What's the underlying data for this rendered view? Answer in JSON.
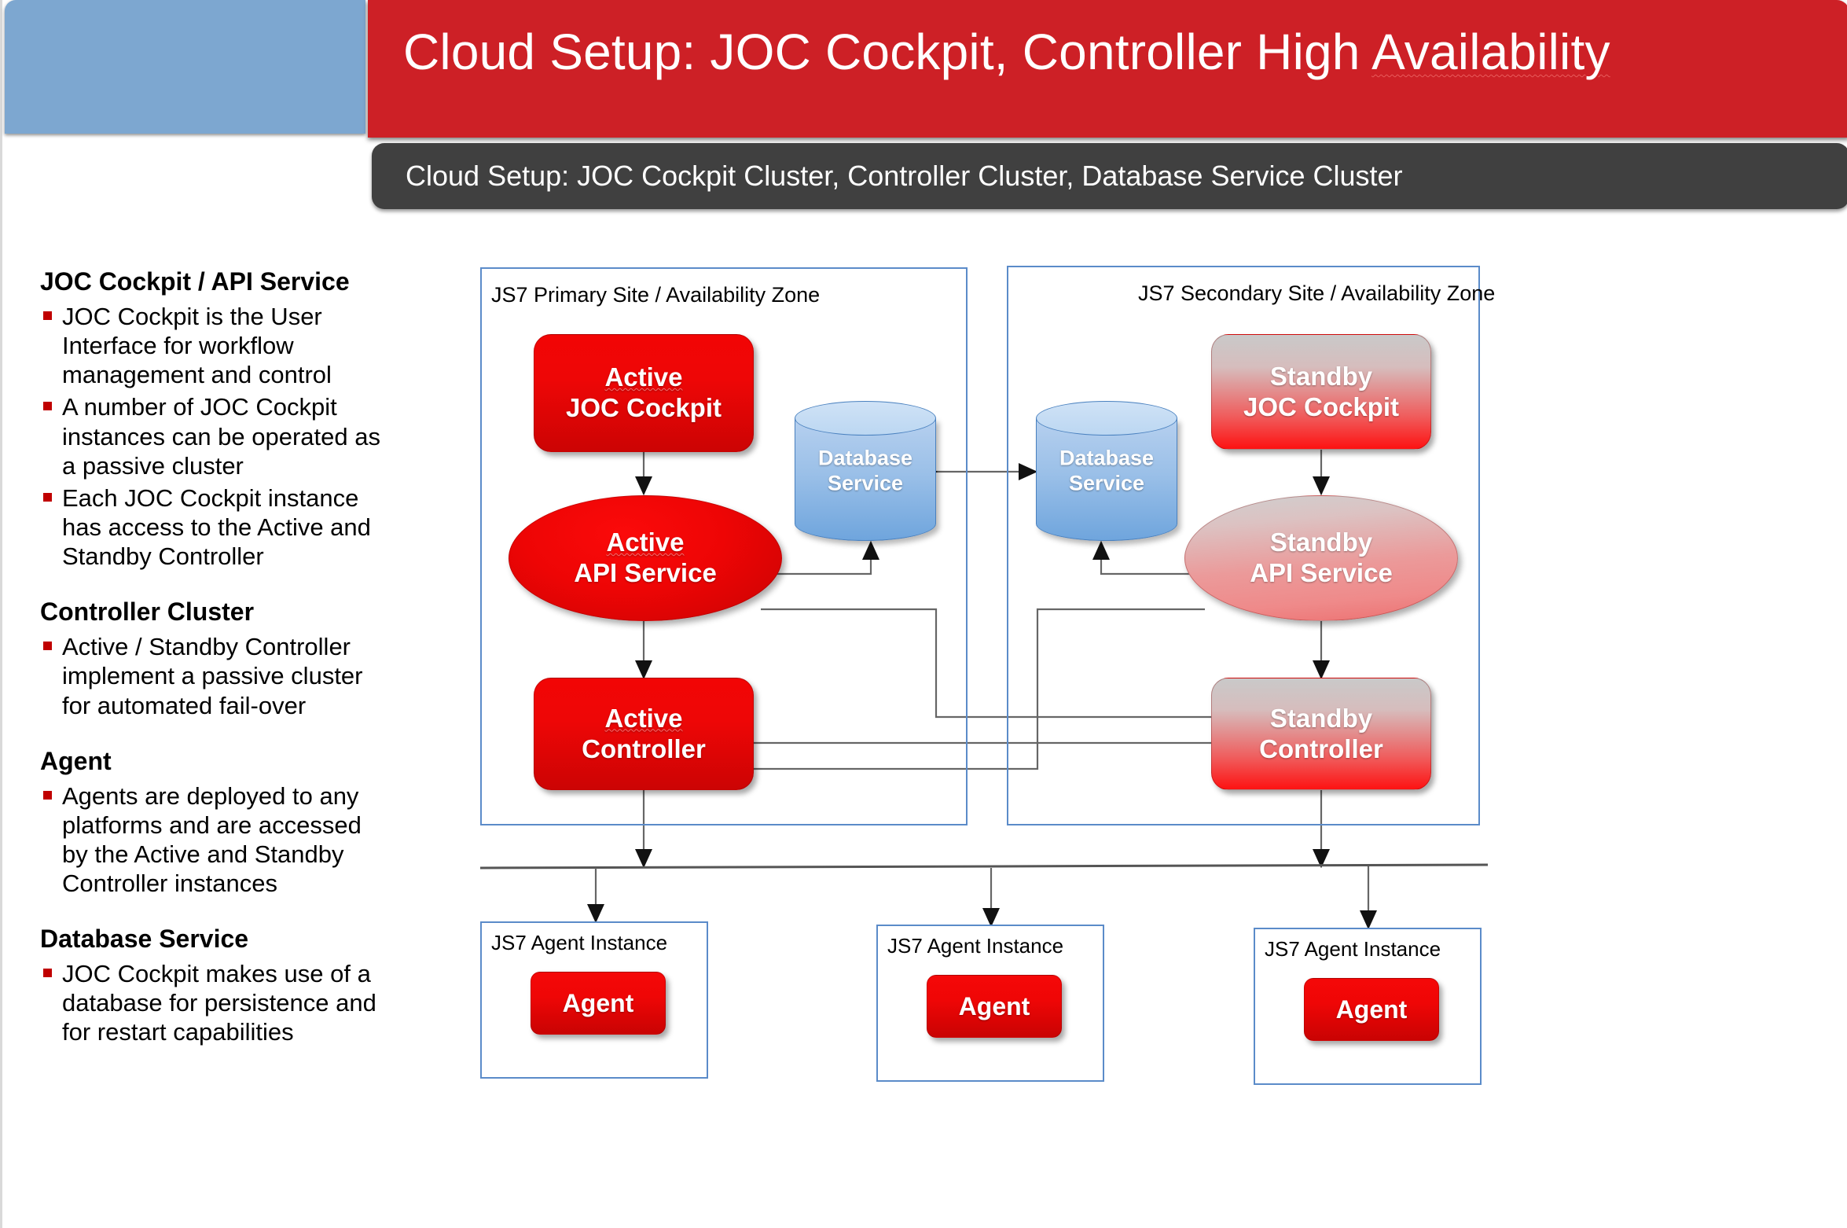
{
  "header": {
    "title_main": "Cloud Setup: JOC Cockpit, Controller High ",
    "title_squiggle": "Availability",
    "subtitle": "Cloud Setup: JOC Cockpit Cluster, Controller Cluster, Database Service Cluster",
    "brand_red": "#cd2026",
    "subtitle_bg": "#404040",
    "blue_panel_color": "#7da7d0"
  },
  "sidebar": {
    "groups": [
      {
        "heading": "JOC Cockpit / API Service",
        "items": [
          "JOC Cockpit is the User Interface for workflow management and control",
          "A number of JOC Cockpit instances can be operated as a passive cluster",
          "Each JOC Cockpit instance has access to the Active and Standby Controller"
        ]
      },
      {
        "heading": "Controller Cluster",
        "items": [
          "Active / Standby Controller implement a passive cluster for automated fail-over"
        ]
      },
      {
        "heading": "Agent",
        "items": [
          "Agents are deployed to any platforms and are accessed by the Active and Standby Controller instances"
        ]
      },
      {
        "heading": "Database Service",
        "items": [
          "JOC Cockpit makes use of a database for persistence and for restart capabilities"
        ]
      }
    ]
  },
  "diagram": {
    "primary_site_label": "JS7 Primary Site / Availability Zone",
    "secondary_site_label": "JS7 Secondary Site / Availability Zone",
    "nodes": {
      "active_joc_line1": "Active",
      "active_joc_line2": "JOC Cockpit",
      "active_api_line1": "Active",
      "active_api_line2": "API Service",
      "active_controller_line1": "Active",
      "active_controller_line2": "Controller",
      "standby_joc_line1": "Standby",
      "standby_joc_line2": "JOC Cockpit",
      "standby_api_line1": "Standby",
      "standby_api_line2": "API Service",
      "standby_controller_line1": "Standby",
      "standby_controller_line2": "Controller",
      "db_primary_line1": "Database",
      "db_primary_line2": "Service",
      "db_secondary_line1": "Database",
      "db_secondary_line2": "Service"
    },
    "agents": [
      {
        "caption": "JS7 Agent Instance",
        "label": "Agent"
      },
      {
        "caption": "JS7 Agent Instance",
        "label": "Agent"
      },
      {
        "caption": "JS7 Agent Instance",
        "label": "Agent"
      }
    ],
    "colors": {
      "site_border": "#5b8bc9",
      "active_red": "#ee0505",
      "db_blue": "#8ab6e3",
      "connector": "#595959"
    }
  }
}
